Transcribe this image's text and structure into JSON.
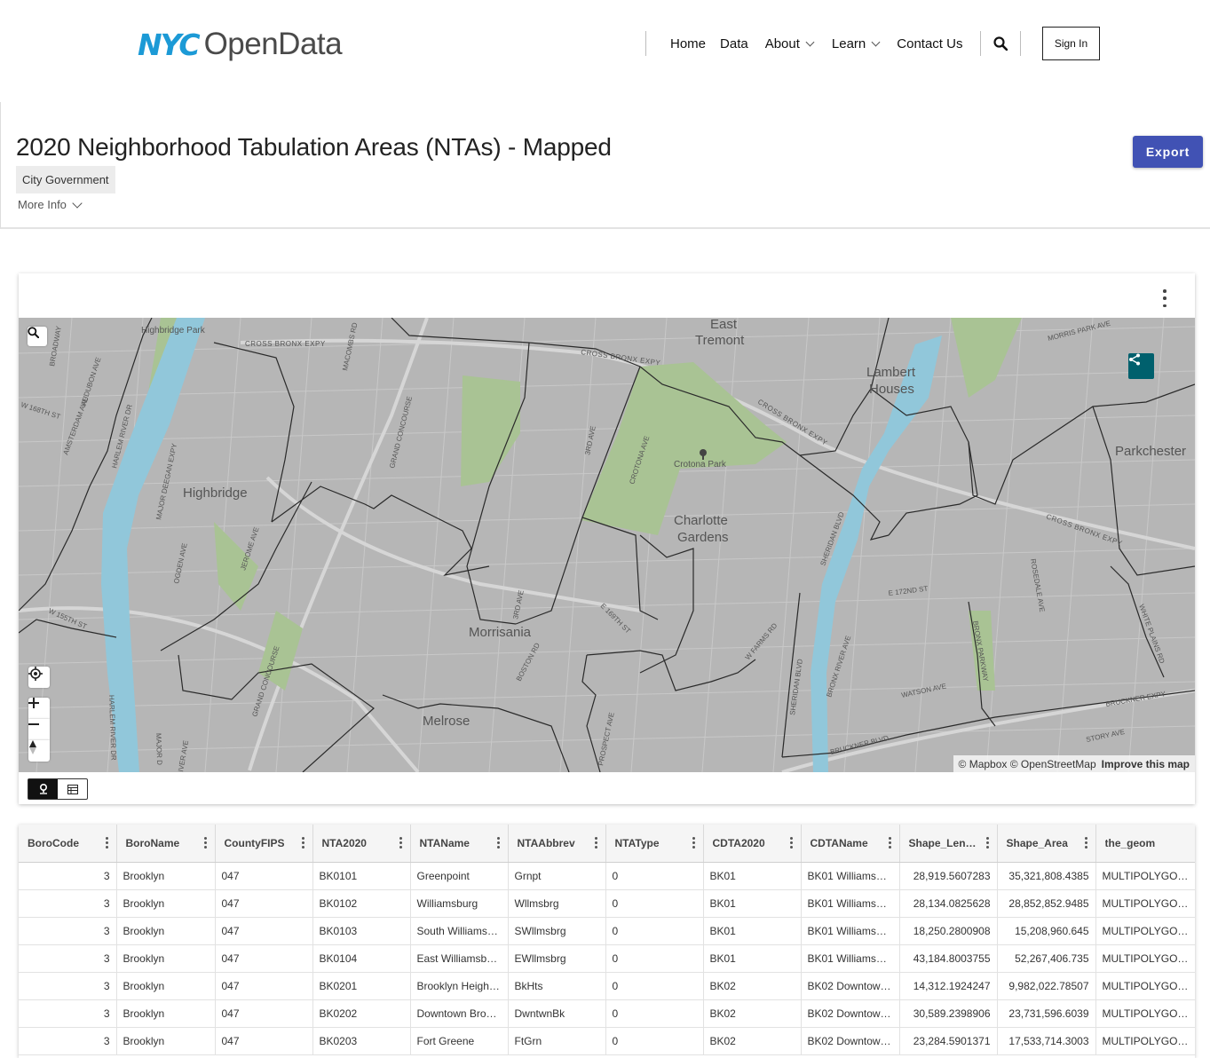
{
  "header": {
    "logo_nyc": "NYC",
    "logo_opendata": "OpenData",
    "nav": [
      {
        "label": "Home"
      },
      {
        "label": "Data"
      },
      {
        "label": "About"
      },
      {
        "label": "Learn"
      },
      {
        "label": "Contact Us"
      }
    ],
    "sign_in": "Sign In"
  },
  "dataset": {
    "title": "2020 Neighborhood Tabulation Areas (NTAs) - Mapped",
    "category": "City Government",
    "more_info": "More Info",
    "export_label": "Export"
  },
  "map": {
    "labels": {
      "highbridge_park": "Highbridge Park",
      "cross_bronx_1": "CROSS BRONX EXPY",
      "cross_bronx_2": "CROSS BRONX EXPY",
      "cross_bronx_3": "CROSS BRONX EXPY",
      "cross_bronx_4": "CROSS BRONX EXPY",
      "east_tremont": "East\nTremont",
      "east": "East",
      "tremont": "Tremont",
      "lambert": "Lambert",
      "houses": "Houses",
      "morris_park": "MORRIS PARK AVE",
      "broadway": "BROADWAY",
      "audubon": "AUDUBON AVE",
      "w168": "W 168TH ST",
      "amsterdam": "AMSTERDAM AVE",
      "harlem_river_dr": "HARLEM RIVER DR",
      "harlem_river_dr2": "HARLEM RIVER DR",
      "major_deegan": "MAJOR DEEGAN EXPY",
      "major_d": "MAJOR D",
      "macombs": "MACOMBS RD",
      "grand_concourse": "GRAND CONCOURSE",
      "grand_concourse2": "GRAND CONCOURSE",
      "third_ave": "3RD AVE",
      "third_ave2": "3RD AVE",
      "crotona_ave": "CROTONA AVE",
      "crotona_park": "Crotona Park",
      "parkchester": "Parkchester",
      "highbridge": "Highbridge",
      "charlotte": "Charlotte",
      "gardens": "Gardens",
      "ogden": "OGDEN AVE",
      "jerome": "JEROME AVE",
      "sheridan": "SHERIDAN BLVD",
      "sheridan2": "SHERIDAN BLVD",
      "e172": "E 172ND ST",
      "rosedale": "ROSEDALE AVE",
      "morrisania": "Morrisania",
      "e169": "E 169TH ST",
      "w_farms": "W FARMS RD",
      "bronx_river_ave": "BRONX RIVER AVE",
      "bronx_parkway": "BRONX PARKWAY",
      "white_plains": "WHITE PLAINS RD",
      "w155": "W 155TH ST",
      "boston_rd": "BOSTON RD",
      "watson": "WATSON AVE",
      "bruckner_expy": "BRUCKNER EXPY",
      "melrose": "Melrose",
      "prospect": "PROSPECT AVE",
      "bruckner_blvd": "BRUCKNER BLVD",
      "story": "STORY AVE",
      "river_ave": "IVER AVE"
    },
    "attribution_mapbox": "© Mapbox",
    "attribution_osm": "© OpenStreetMap",
    "improve": "Improve this map"
  },
  "table": {
    "columns": [
      "BoroCode",
      "BoroName",
      "CountyFIPS",
      "NTA2020",
      "NTAName",
      "NTAAbbrev",
      "NTAType",
      "CDTA2020",
      "CDTAName",
      "Shape_Leng",
      "Shape_Area",
      "the_geom"
    ],
    "column_display": [
      "BoroCode",
      "BoroName",
      "CountyFIPS",
      "NTA2020",
      "NTAName",
      "NTAAbbrev",
      "NTAType",
      "CDTA2020",
      "CDTAName",
      "Shape_Len…",
      "Shape_Area",
      "the_geom"
    ],
    "rows": [
      [
        "3",
        "Brooklyn",
        "047",
        "BK0101",
        "Greenpoint",
        "Grnpt",
        "0",
        "BK01",
        "BK01 Williams…",
        "28,919.5607283",
        "35,321,808.4385",
        "MULTIPOLYGO…"
      ],
      [
        "3",
        "Brooklyn",
        "047",
        "BK0102",
        "Williamsburg",
        "Wllmsbrg",
        "0",
        "BK01",
        "BK01 Williams…",
        "28,134.0825628",
        "28,852,852.9485",
        "MULTIPOLYGO…"
      ],
      [
        "3",
        "Brooklyn",
        "047",
        "BK0103",
        "South Williams…",
        "SWllmsbrg",
        "0",
        "BK01",
        "BK01 Williams…",
        "18,250.2800908",
        "15,208,960.645",
        "MULTIPOLYGO…"
      ],
      [
        "3",
        "Brooklyn",
        "047",
        "BK0104",
        "East Williamsb…",
        "EWllmsbrg",
        "0",
        "BK01",
        "BK01 Williams…",
        "43,184.8003755",
        "52,267,406.735",
        "MULTIPOLYGO…"
      ],
      [
        "3",
        "Brooklyn",
        "047",
        "BK0201",
        "Brooklyn Heigh…",
        "BkHts",
        "0",
        "BK02",
        "BK02 Downtow…",
        "14,312.1924247",
        "9,982,022.78507",
        "MULTIPOLYGO…"
      ],
      [
        "3",
        "Brooklyn",
        "047",
        "BK0202",
        "Downtown Bro…",
        "DwntwnBk",
        "0",
        "BK02",
        "BK02 Downtow…",
        "30,589.2398906",
        "23,731,596.6039",
        "MULTIPOLYGO…"
      ],
      [
        "3",
        "Brooklyn",
        "047",
        "BK0203",
        "Fort Greene",
        "FtGrn",
        "0",
        "BK02",
        "BK02 Downtow…",
        "23,284.5901371",
        "17,533,714.3003",
        "MULTIPOLYGO…"
      ]
    ]
  },
  "colors": {
    "brand_blue": "#1c9ad6",
    "export_button": "#4152b4",
    "share_button": "#00606d",
    "map_land": "#b6b6b6",
    "map_park": "#a6c08f",
    "map_water": "#8fc8dc"
  }
}
